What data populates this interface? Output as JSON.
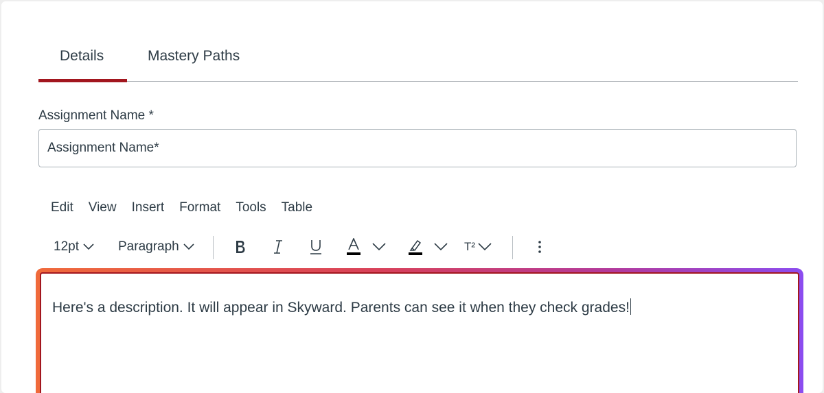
{
  "tabs": [
    {
      "label": "Details",
      "active": true
    },
    {
      "label": "Mastery Paths",
      "active": false
    }
  ],
  "assignment_name": {
    "label": "Assignment Name *",
    "value": "Assignment Name*"
  },
  "menubar": [
    "Edit",
    "View",
    "Insert",
    "Format",
    "Tools",
    "Table"
  ],
  "toolbar": {
    "font_size": "12pt",
    "block_format": "Paragraph",
    "superscript_label": "T²"
  },
  "editor": {
    "content": "Here's a description.  It will appear in Skyward.  Parents can see it when they check grades!"
  },
  "colors": {
    "accent": "#a2161e",
    "text": "#2d3b45",
    "focus_gradient": [
      "#f06a3b",
      "#d8415a",
      "#b23a9c",
      "#8b4cf0"
    ]
  }
}
